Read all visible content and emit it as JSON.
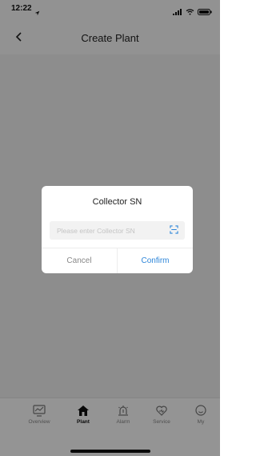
{
  "status_bar": {
    "time": "12:22"
  },
  "nav": {
    "title": "Create Plant"
  },
  "tabs": [
    {
      "label": "Overview",
      "icon": "overview-icon",
      "active": false
    },
    {
      "label": "Plant",
      "icon": "plant-home-icon",
      "active": true
    },
    {
      "label": "Alarm",
      "icon": "alarm-icon",
      "active": false
    },
    {
      "label": "Service",
      "icon": "service-icon",
      "active": false
    },
    {
      "label": "My",
      "icon": "user-icon",
      "active": false
    }
  ],
  "dialog": {
    "title": "Collector SN",
    "input_placeholder": "Please enter Collector SN",
    "input_value": "",
    "cancel_label": "Cancel",
    "confirm_label": "Confirm"
  },
  "colors": {
    "accent": "#2e86d9",
    "overlay": "rgba(0,0,0,0.42)"
  }
}
